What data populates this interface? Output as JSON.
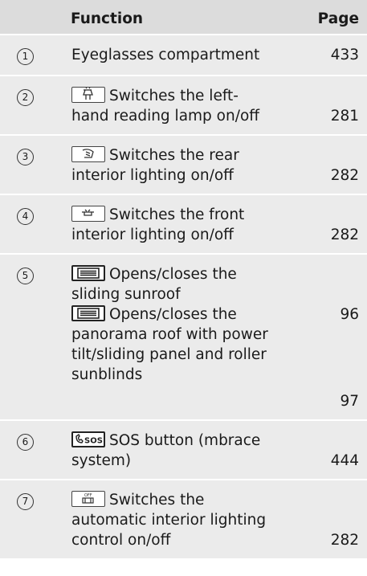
{
  "table": {
    "headers": {
      "function": "Function",
      "page": "Page"
    },
    "rows": [
      {
        "number": "1",
        "lines": [
          "Eyeglasses compartment"
        ],
        "icon": null,
        "pages": [
          "433"
        ]
      },
      {
        "number": "2",
        "icon": "reading-lamp-icon",
        "lines": [
          "Switches the left-",
          "hand reading lamp on/off"
        ],
        "pages": [
          "281"
        ]
      },
      {
        "number": "3",
        "icon": "rear-interior-light-icon",
        "lines": [
          "Switches the rear",
          "interior lighting on/off"
        ],
        "pages": [
          "282"
        ]
      },
      {
        "number": "4",
        "icon": "front-interior-light-icon",
        "lines": [
          "Switches the front",
          "interior lighting on/off"
        ],
        "pages": [
          "282"
        ]
      },
      {
        "number": "5",
        "entries": [
          {
            "icon": "sliding-sunroof-icon",
            "lines": [
              "Opens/closes the",
              "sliding sunroof"
            ],
            "page": "96"
          },
          {
            "icon": "panorama-roof-icon",
            "lines": [
              "Opens/closes the",
              "panorama roof with power",
              "tilt/sliding panel and roller",
              "sunblinds"
            ],
            "page": "97"
          }
        ]
      },
      {
        "number": "6",
        "icon": "sos-button-icon",
        "icon_text": "SOS",
        "lines": [
          "SOS button (mbrace",
          "system)"
        ],
        "pages": [
          "444"
        ]
      },
      {
        "number": "7",
        "icon": "automatic-lighting-off-icon",
        "icon_text": "OFF",
        "lines": [
          "Switches the",
          "automatic interior lighting",
          "control on/off"
        ],
        "pages": [
          "282"
        ]
      }
    ]
  }
}
